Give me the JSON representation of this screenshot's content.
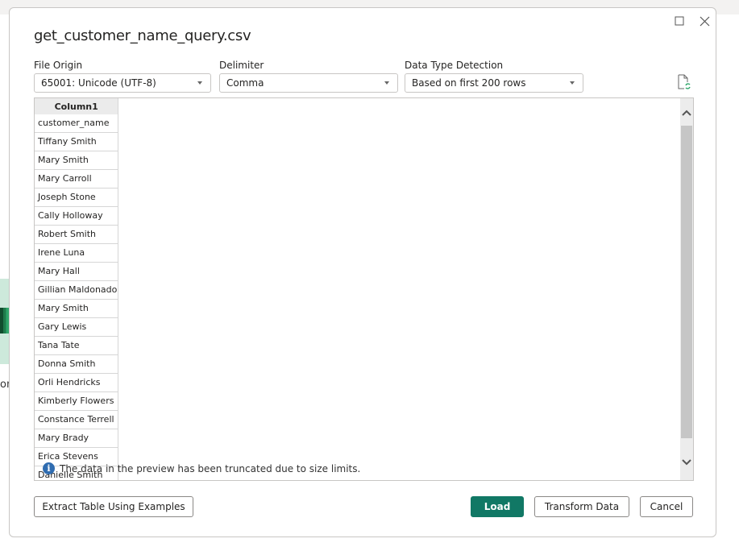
{
  "dialog": {
    "title": "get_customer_name_query.csv",
    "window_controls": {
      "maximize_icon": "maximize-icon",
      "close_icon": "close-icon"
    }
  },
  "options": {
    "file_origin": {
      "label": "File Origin",
      "value": "65001: Unicode (UTF-8)"
    },
    "delimiter": {
      "label": "Delimiter",
      "value": "Comma"
    },
    "data_type_detection": {
      "label": "Data Type Detection",
      "value": "Based on first 200 rows"
    },
    "refresh_icon": "file-refresh-icon"
  },
  "preview": {
    "column_header": "Column1",
    "rows": [
      "customer_name",
      "Tiffany Smith",
      "Mary Smith",
      "Mary Carroll",
      "Joseph Stone",
      "Cally Holloway",
      "Robert Smith",
      "Irene Luna",
      "Mary Hall",
      "Gillian Maldonado",
      "Mary Smith",
      "Gary Lewis",
      "Tana Tate",
      "Donna Smith",
      "Orli Hendricks",
      "Kimberly Flowers",
      "Constance Terrell",
      "Mary Brady",
      "Erica Stevens",
      "Danielle Smith"
    ],
    "info_message": "The data in the preview has been truncated due to size limits."
  },
  "buttons": {
    "extract": "Extract Table Using Examples",
    "load": "Load",
    "transform": "Transform Data",
    "cancel": "Cancel"
  },
  "background": {
    "partial_text": "om"
  },
  "colors": {
    "primary": "#117865",
    "info": "#2f6cb0"
  }
}
